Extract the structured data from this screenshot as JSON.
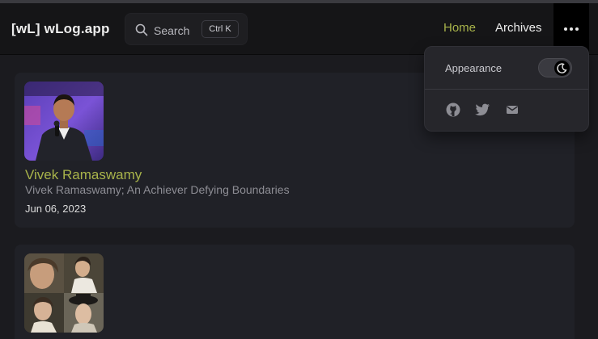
{
  "site": {
    "brand": "[wL] wLog.app"
  },
  "search": {
    "label": "Search",
    "shortcut": "Ctrl K"
  },
  "nav": {
    "items": [
      {
        "label": "Home",
        "active": true
      },
      {
        "label": "Archives",
        "active": false
      }
    ],
    "more_icon": "ellipsis-icon"
  },
  "menu": {
    "appearance_label": "Appearance",
    "theme_toggle_icon": "moon-icon",
    "social": [
      "github-icon",
      "twitter-icon",
      "mail-icon"
    ]
  },
  "posts": [
    {
      "title": "Vivek Ramaswamy",
      "subtitle": "Vivek Ramaswamy; An Achiever Defying Boundaries",
      "date": "Jun 06, 2023",
      "thumbnail": "speaker-photo"
    },
    {
      "thumbnail": "portrait-collage"
    }
  ],
  "colors": {
    "accent": "#a8b34a",
    "background": "#1b1b1f",
    "card": "#202127",
    "navbar": "#151517"
  }
}
